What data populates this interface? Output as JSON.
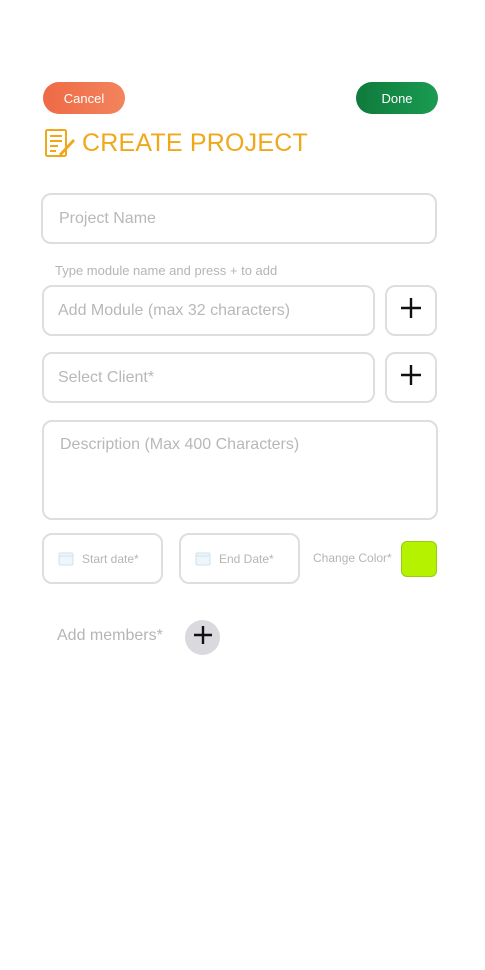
{
  "header": {
    "cancel_label": "Cancel",
    "done_label": "Done",
    "title": "CREATE PROJECT",
    "title_icon": "document-edit-icon"
  },
  "form": {
    "project_name_placeholder": "Project Name",
    "module_hint": "Type module name and press + to add",
    "module_placeholder": "Add Module (max 32 characters)",
    "client_placeholder": "Select Client*",
    "description_placeholder": "Description (Max 400 Characters)",
    "start_date_label": "Start date*",
    "end_date_label": "End Date*",
    "change_color_label": "Change Color*",
    "selected_color": "#b5f200",
    "add_members_label": "Add members*"
  },
  "colors": {
    "cancel": "#ee6a45",
    "done": "#0f7a3c",
    "title": "#f0a81b"
  }
}
